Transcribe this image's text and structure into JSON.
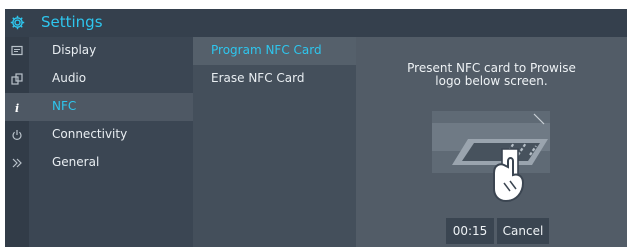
{
  "header": {
    "title": "Settings",
    "icon": "gear-icon"
  },
  "nav": {
    "items": [
      {
        "label": "Display",
        "icon": "display-icon",
        "selected": false
      },
      {
        "label": "Audio",
        "icon": "audio-icon",
        "selected": false
      },
      {
        "label": "NFC",
        "icon": "info-icon",
        "selected": true
      },
      {
        "label": "Connectivity",
        "icon": "power-icon",
        "selected": false
      },
      {
        "label": "General",
        "icon": "chevrons-right-icon",
        "selected": false
      }
    ]
  },
  "submenu": {
    "items": [
      {
        "label": "Program NFC Card",
        "selected": true
      },
      {
        "label": "Erase NFC Card",
        "selected": false
      }
    ]
  },
  "content": {
    "instruction": "Present NFC card to Prowise\nlogo below screen.",
    "timer": "00:15",
    "cancel_label": "Cancel"
  },
  "colors": {
    "accent": "#2ec6ee",
    "titlebar": "#35404d",
    "panel": "#525c67"
  }
}
